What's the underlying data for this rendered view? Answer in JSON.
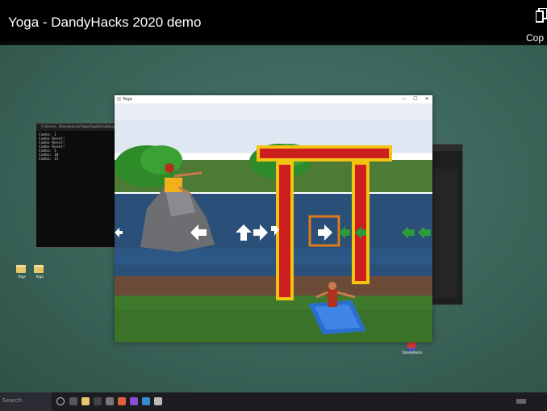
{
  "video": {
    "title": "Yoga - DandyHacks 2020 demo",
    "copy_label": "Cop"
  },
  "console": {
    "title": "C:\\Users\\...\\DandyHacks\\Yoga\\Yoga\\bin\\Debug\\Yoga.exe",
    "lines": "Combo: 1\nCombo Reset!\nCombo Reset!\nCombo Reset!\nCombo: 5\nCombo: 10\nCombo: 15"
  },
  "desktop_icons": [
    {
      "label": "Yoga"
    },
    {
      "label": "Yoga"
    }
  ],
  "doc_icon": {
    "label": "DandyHacks"
  },
  "game_window": {
    "title": "Yoga",
    "minimize": "—",
    "maximize": "☐",
    "close": "✕"
  },
  "taskbar": {
    "search_hint": "Search"
  },
  "colors": {
    "sky": "#e9eef6",
    "river": "#2a4f78",
    "grass": "#3f7a2c",
    "dirt": "#6b4a38",
    "gate_red": "#cc1e1e",
    "gate_gold": "#f2c313",
    "target_orange": "#e07a1a",
    "mat_blue": "#2a6fd0"
  },
  "icons": [
    "copy-icon",
    "window-app-icon",
    "minimize-icon",
    "maximize-icon",
    "close-icon",
    "folder-icon",
    "windows-start-icon"
  ]
}
